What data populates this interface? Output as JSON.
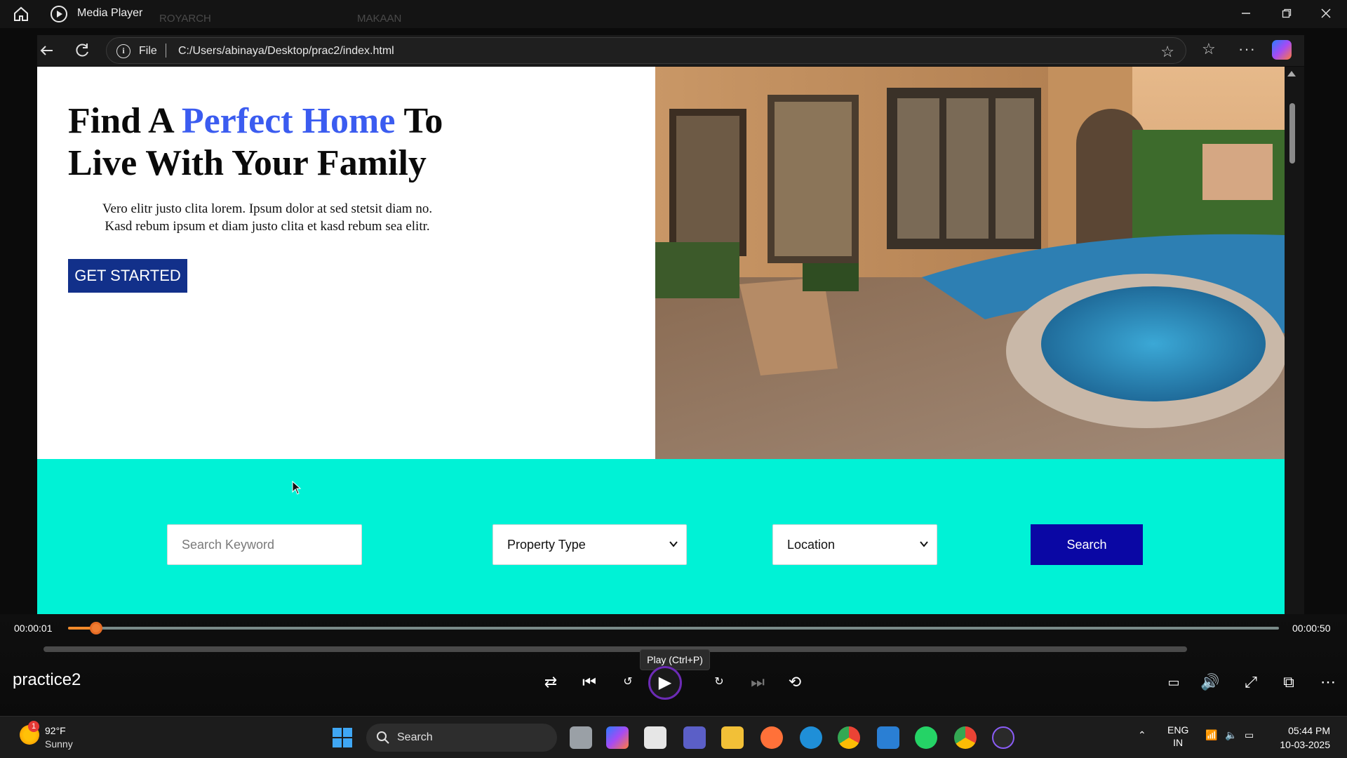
{
  "player": {
    "app_title": "Media Player",
    "media_title": "practice2",
    "time_current": "00:00:01",
    "time_total": "00:00:50",
    "progress_fraction": 0.02,
    "play_tooltip": "Play (Ctrl+P)",
    "accent": "#f07c32"
  },
  "ghost_tabs": [
    "ROYARCH",
    "MAKAAN"
  ],
  "browser": {
    "scheme_label": "File",
    "url": "C:/Users/abinaya/Desktop/prac2/index.html"
  },
  "hero": {
    "title_part1": "Find A ",
    "title_accent": "Perfect Home",
    "title_part2": " To",
    "title_line2": "Live With Your Family",
    "description_line1": "Vero elitr justo clita lorem. Ipsum dolor at sed stetsit diam no.",
    "description_line2": "Kasd rebum ipsum et diam justo clita et kasd rebum sea elitr.",
    "cta_label": "GET STARTED",
    "accent_color": "#3b5cf0",
    "cta_color": "#12308a"
  },
  "search": {
    "keyword_placeholder": "Search Keyword",
    "property_type": "Property Type",
    "location": "Location",
    "button_label": "Search",
    "band_color": "#00f2d6",
    "button_color": "#0a07a4"
  },
  "taskbar": {
    "weather_temp": "92°F",
    "weather_condition": "Sunny",
    "weather_badge": "1",
    "search_label": "Search",
    "lang_line1": "ENG",
    "lang_line2": "IN",
    "time": "05:44 PM",
    "date": "10-03-2025"
  }
}
